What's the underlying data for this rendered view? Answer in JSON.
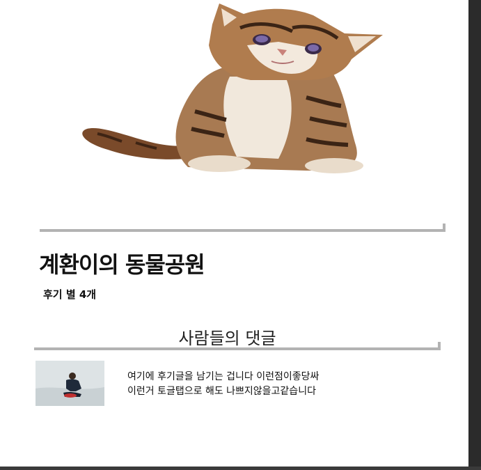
{
  "profile": {
    "hero_image": "kitten-photo",
    "title": "계환이의 동물공원",
    "review_count": "후기 별 4개"
  },
  "comments_section": {
    "heading": "사람들의 댓글",
    "comments": [
      {
        "thumbnail": "person-sitting-on-ice-photo",
        "line1": "여기에 후기글을 남기는 겁니다 이런점이좋당싸",
        "line2": "이런거 토글탭으로 해도 나쁘지않을고같습니다"
      }
    ]
  },
  "colors": {
    "page_background": "#ffffff",
    "divider": "#b3b3b3",
    "right_edge": "#2b2b2b"
  }
}
